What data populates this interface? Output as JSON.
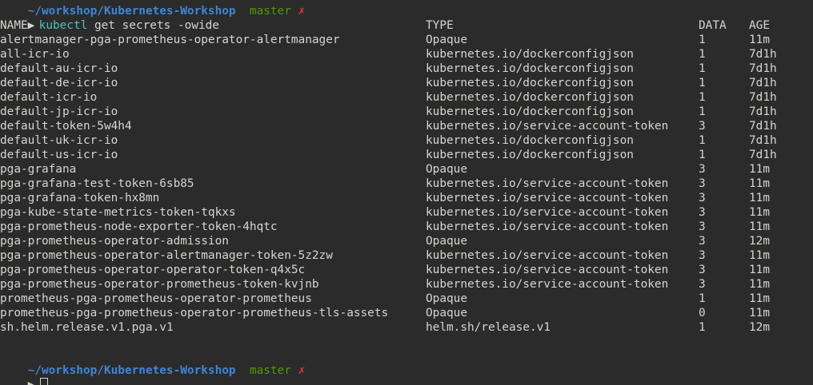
{
  "top_prompt": {
    "path": "~/workshop/Kubernetes-Workshop",
    "branch": "master",
    "dirty": "✗"
  },
  "command": {
    "arrow": "▶",
    "name": "kubectl",
    "args": "get secrets -owide"
  },
  "headers": {
    "name": "NAME",
    "type": "TYPE",
    "data": "DATA",
    "age": "AGE"
  },
  "rows": [
    {
      "name": "alertmanager-pga-prometheus-operator-alertmanager",
      "type": "Opaque",
      "data": "1",
      "age": "11m"
    },
    {
      "name": "all-icr-io",
      "type": "kubernetes.io/dockerconfigjson",
      "data": "1",
      "age": "7d1h"
    },
    {
      "name": "default-au-icr-io",
      "type": "kubernetes.io/dockerconfigjson",
      "data": "1",
      "age": "7d1h"
    },
    {
      "name": "default-de-icr-io",
      "type": "kubernetes.io/dockerconfigjson",
      "data": "1",
      "age": "7d1h"
    },
    {
      "name": "default-icr-io",
      "type": "kubernetes.io/dockerconfigjson",
      "data": "1",
      "age": "7d1h"
    },
    {
      "name": "default-jp-icr-io",
      "type": "kubernetes.io/dockerconfigjson",
      "data": "1",
      "age": "7d1h"
    },
    {
      "name": "default-token-5w4h4",
      "type": "kubernetes.io/service-account-token",
      "data": "3",
      "age": "7d1h"
    },
    {
      "name": "default-uk-icr-io",
      "type": "kubernetes.io/dockerconfigjson",
      "data": "1",
      "age": "7d1h"
    },
    {
      "name": "default-us-icr-io",
      "type": "kubernetes.io/dockerconfigjson",
      "data": "1",
      "age": "7d1h"
    },
    {
      "name": "pga-grafana",
      "type": "Opaque",
      "data": "3",
      "age": "11m"
    },
    {
      "name": "pga-grafana-test-token-6sb85",
      "type": "kubernetes.io/service-account-token",
      "data": "3",
      "age": "11m"
    },
    {
      "name": "pga-grafana-token-hx8mn",
      "type": "kubernetes.io/service-account-token",
      "data": "3",
      "age": "11m"
    },
    {
      "name": "pga-kube-state-metrics-token-tqkxs",
      "type": "kubernetes.io/service-account-token",
      "data": "3",
      "age": "11m"
    },
    {
      "name": "pga-prometheus-node-exporter-token-4hqtc",
      "type": "kubernetes.io/service-account-token",
      "data": "3",
      "age": "11m"
    },
    {
      "name": "pga-prometheus-operator-admission",
      "type": "Opaque",
      "data": "3",
      "age": "12m"
    },
    {
      "name": "pga-prometheus-operator-alertmanager-token-5z2zw",
      "type": "kubernetes.io/service-account-token",
      "data": "3",
      "age": "11m"
    },
    {
      "name": "pga-prometheus-operator-operator-token-q4x5c",
      "type": "kubernetes.io/service-account-token",
      "data": "3",
      "age": "11m"
    },
    {
      "name": "pga-prometheus-operator-prometheus-token-kvjnb",
      "type": "kubernetes.io/service-account-token",
      "data": "3",
      "age": "11m"
    },
    {
      "name": "prometheus-pga-prometheus-operator-prometheus",
      "type": "Opaque",
      "data": "1",
      "age": "11m"
    },
    {
      "name": "prometheus-pga-prometheus-operator-prometheus-tls-assets",
      "type": "Opaque",
      "data": "0",
      "age": "11m"
    },
    {
      "name": "sh.helm.release.v1.pga.v1",
      "type": "helm.sh/release.v1",
      "data": "1",
      "age": "12m"
    }
  ],
  "bottom_prompt": {
    "path": "~/workshop/Kubernetes-Workshop",
    "branch": "master",
    "dirty": "✗",
    "arrow": "▶"
  },
  "colors": {
    "background": "#2b2b2b",
    "text": "#d3d7cf",
    "path": "#3f86d6",
    "branch": "#4e9a06",
    "dirty": "#e53935",
    "command": "#4ec2b8"
  }
}
